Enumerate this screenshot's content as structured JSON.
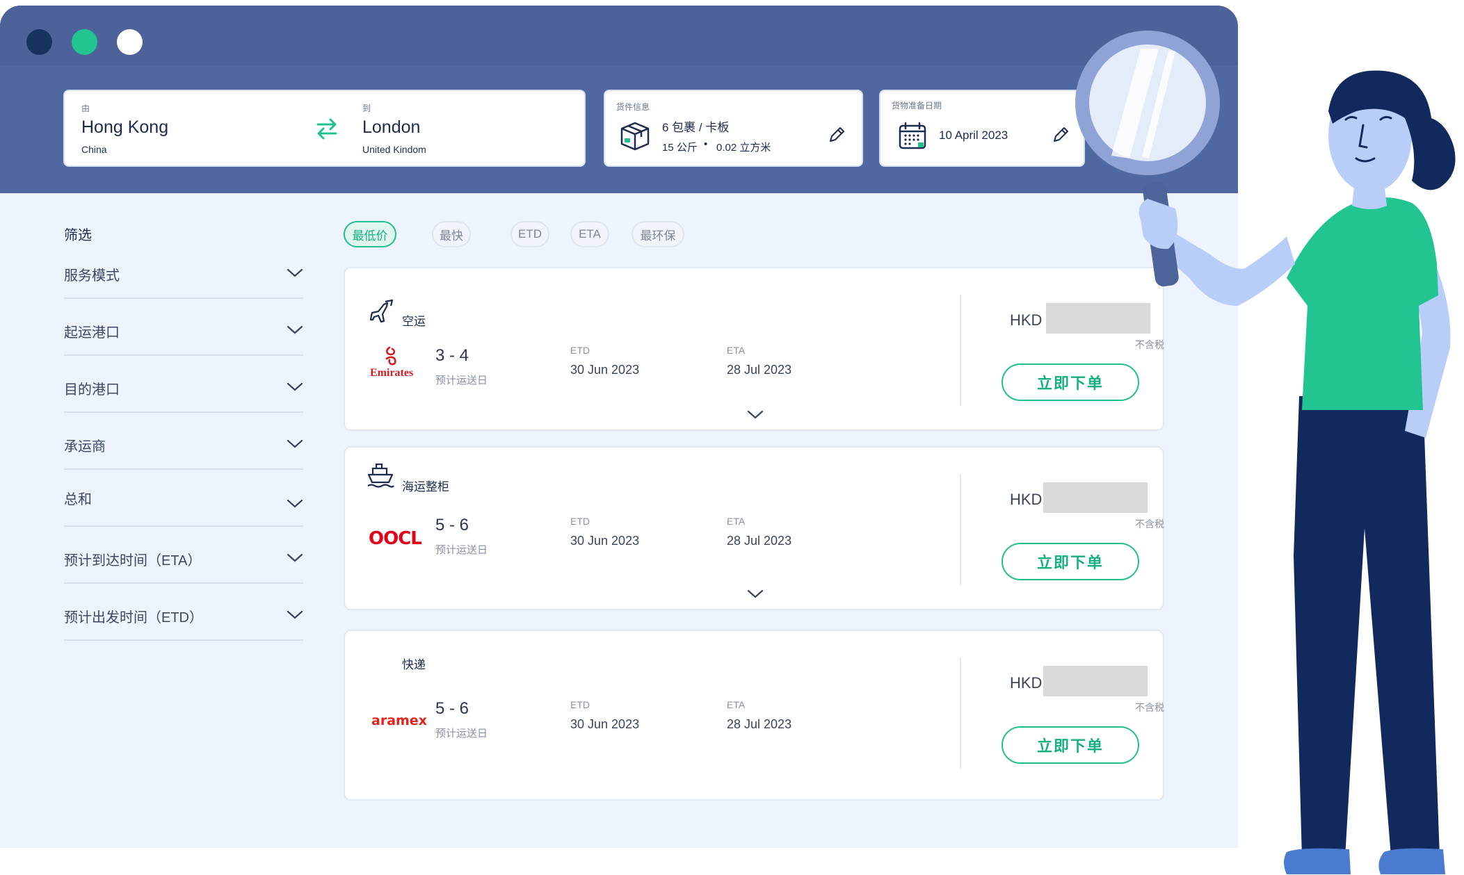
{
  "window": {
    "dot_colors": [
      "#183260",
      "#22c591",
      "#ffffff"
    ]
  },
  "search": {
    "from_label": "由",
    "from_city": "Hong Kong",
    "from_country": "China",
    "to_label": "到",
    "to_city": "London",
    "to_country": "United Kindom",
    "cargo_label": "货件信息",
    "cargo_main": "6 包裹 / 卡板",
    "cargo_weight": "15 公斤",
    "cargo_volume": "0.02 立方米",
    "ready_label": "货物准备日期",
    "ready_date": "10 April 2023"
  },
  "sidebar": {
    "title": "筛选",
    "filters": [
      {
        "label": "服务模式"
      },
      {
        "label": "起运港口"
      },
      {
        "label": "目的港口"
      },
      {
        "label": "承运商"
      },
      {
        "label": "总和"
      },
      {
        "label": "预计到达时间（ETA）"
      },
      {
        "label": "预计出发时间（ETD）"
      }
    ]
  },
  "sort_chips": [
    {
      "label": "最低价",
      "active": true
    },
    {
      "label": "最快",
      "active": false
    },
    {
      "label": "ETD",
      "active": false
    },
    {
      "label": "ETA",
      "active": false
    },
    {
      "label": "最环保",
      "active": false
    }
  ],
  "results": [
    {
      "mode": "空运",
      "mode_icon": "airplane-icon",
      "carrier": "Emirates",
      "days": "3 - 4",
      "days_label": "预计运送日",
      "etd_label": "ETD",
      "etd": "30 Jun 2023",
      "eta_label": "ETA",
      "eta": "28 Jul 2023",
      "currency": "HKD",
      "tax_note": "不含税",
      "order_label": "立即下单"
    },
    {
      "mode": "海运整柜",
      "mode_icon": "ship-icon",
      "carrier": "OOCL",
      "days": "5 - 6",
      "days_label": "预计运送日",
      "etd_label": "ETD",
      "etd": "30 Jun 2023",
      "eta_label": "ETA",
      "eta": "28 Jul 2023",
      "currency": "HKD",
      "tax_note": "不含税",
      "order_label": "立即下单"
    },
    {
      "mode": "快递",
      "mode_icon": "",
      "carrier": "aramex",
      "days": "5 - 6",
      "days_label": "预计运送日",
      "etd_label": "ETD",
      "etd": "30 Jun 2023",
      "eta_label": "ETA",
      "eta": "28 Jul 2023",
      "currency": "HKD",
      "tax_note": "不含税",
      "order_label": "立即下单"
    }
  ],
  "colors": {
    "header": "#4d649b",
    "accent": "#22c08e",
    "emirates": "#d71921",
    "oocl": "#e2001a",
    "aramex": "#e2231a"
  }
}
